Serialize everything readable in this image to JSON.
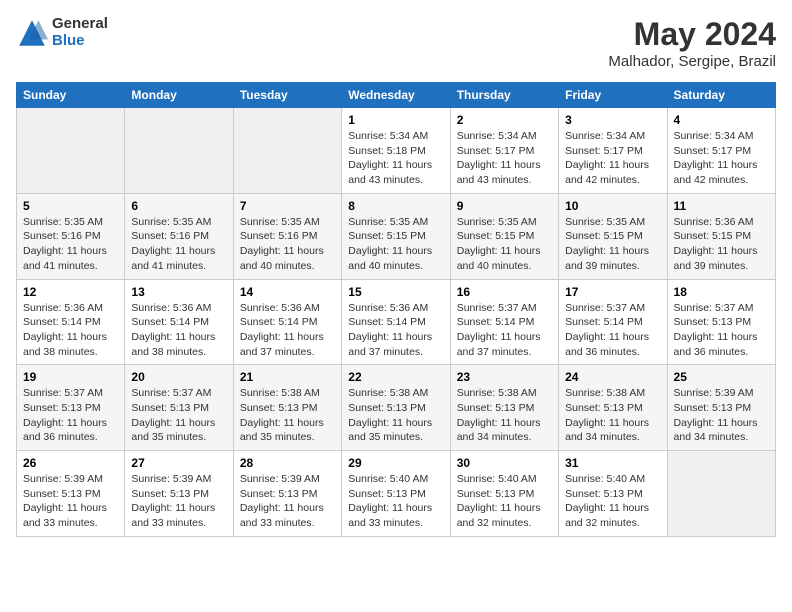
{
  "header": {
    "logo_general": "General",
    "logo_blue": "Blue",
    "month_year": "May 2024",
    "location": "Malhador, Sergipe, Brazil"
  },
  "days_of_week": [
    "Sunday",
    "Monday",
    "Tuesday",
    "Wednesday",
    "Thursday",
    "Friday",
    "Saturday"
  ],
  "weeks": [
    [
      {
        "day": "",
        "info": ""
      },
      {
        "day": "",
        "info": ""
      },
      {
        "day": "",
        "info": ""
      },
      {
        "day": "1",
        "info": "Sunrise: 5:34 AM\nSunset: 5:18 PM\nDaylight: 11 hours\nand 43 minutes."
      },
      {
        "day": "2",
        "info": "Sunrise: 5:34 AM\nSunset: 5:17 PM\nDaylight: 11 hours\nand 43 minutes."
      },
      {
        "day": "3",
        "info": "Sunrise: 5:34 AM\nSunset: 5:17 PM\nDaylight: 11 hours\nand 42 minutes."
      },
      {
        "day": "4",
        "info": "Sunrise: 5:34 AM\nSunset: 5:17 PM\nDaylight: 11 hours\nand 42 minutes."
      }
    ],
    [
      {
        "day": "5",
        "info": "Sunrise: 5:35 AM\nSunset: 5:16 PM\nDaylight: 11 hours\nand 41 minutes."
      },
      {
        "day": "6",
        "info": "Sunrise: 5:35 AM\nSunset: 5:16 PM\nDaylight: 11 hours\nand 41 minutes."
      },
      {
        "day": "7",
        "info": "Sunrise: 5:35 AM\nSunset: 5:16 PM\nDaylight: 11 hours\nand 40 minutes."
      },
      {
        "day": "8",
        "info": "Sunrise: 5:35 AM\nSunset: 5:15 PM\nDaylight: 11 hours\nand 40 minutes."
      },
      {
        "day": "9",
        "info": "Sunrise: 5:35 AM\nSunset: 5:15 PM\nDaylight: 11 hours\nand 40 minutes."
      },
      {
        "day": "10",
        "info": "Sunrise: 5:35 AM\nSunset: 5:15 PM\nDaylight: 11 hours\nand 39 minutes."
      },
      {
        "day": "11",
        "info": "Sunrise: 5:36 AM\nSunset: 5:15 PM\nDaylight: 11 hours\nand 39 minutes."
      }
    ],
    [
      {
        "day": "12",
        "info": "Sunrise: 5:36 AM\nSunset: 5:14 PM\nDaylight: 11 hours\nand 38 minutes."
      },
      {
        "day": "13",
        "info": "Sunrise: 5:36 AM\nSunset: 5:14 PM\nDaylight: 11 hours\nand 38 minutes."
      },
      {
        "day": "14",
        "info": "Sunrise: 5:36 AM\nSunset: 5:14 PM\nDaylight: 11 hours\nand 37 minutes."
      },
      {
        "day": "15",
        "info": "Sunrise: 5:36 AM\nSunset: 5:14 PM\nDaylight: 11 hours\nand 37 minutes."
      },
      {
        "day": "16",
        "info": "Sunrise: 5:37 AM\nSunset: 5:14 PM\nDaylight: 11 hours\nand 37 minutes."
      },
      {
        "day": "17",
        "info": "Sunrise: 5:37 AM\nSunset: 5:14 PM\nDaylight: 11 hours\nand 36 minutes."
      },
      {
        "day": "18",
        "info": "Sunrise: 5:37 AM\nSunset: 5:13 PM\nDaylight: 11 hours\nand 36 minutes."
      }
    ],
    [
      {
        "day": "19",
        "info": "Sunrise: 5:37 AM\nSunset: 5:13 PM\nDaylight: 11 hours\nand 36 minutes."
      },
      {
        "day": "20",
        "info": "Sunrise: 5:37 AM\nSunset: 5:13 PM\nDaylight: 11 hours\nand 35 minutes."
      },
      {
        "day": "21",
        "info": "Sunrise: 5:38 AM\nSunset: 5:13 PM\nDaylight: 11 hours\nand 35 minutes."
      },
      {
        "day": "22",
        "info": "Sunrise: 5:38 AM\nSunset: 5:13 PM\nDaylight: 11 hours\nand 35 minutes."
      },
      {
        "day": "23",
        "info": "Sunrise: 5:38 AM\nSunset: 5:13 PM\nDaylight: 11 hours\nand 34 minutes."
      },
      {
        "day": "24",
        "info": "Sunrise: 5:38 AM\nSunset: 5:13 PM\nDaylight: 11 hours\nand 34 minutes."
      },
      {
        "day": "25",
        "info": "Sunrise: 5:39 AM\nSunset: 5:13 PM\nDaylight: 11 hours\nand 34 minutes."
      }
    ],
    [
      {
        "day": "26",
        "info": "Sunrise: 5:39 AM\nSunset: 5:13 PM\nDaylight: 11 hours\nand 33 minutes."
      },
      {
        "day": "27",
        "info": "Sunrise: 5:39 AM\nSunset: 5:13 PM\nDaylight: 11 hours\nand 33 minutes."
      },
      {
        "day": "28",
        "info": "Sunrise: 5:39 AM\nSunset: 5:13 PM\nDaylight: 11 hours\nand 33 minutes."
      },
      {
        "day": "29",
        "info": "Sunrise: 5:40 AM\nSunset: 5:13 PM\nDaylight: 11 hours\nand 33 minutes."
      },
      {
        "day": "30",
        "info": "Sunrise: 5:40 AM\nSunset: 5:13 PM\nDaylight: 11 hours\nand 32 minutes."
      },
      {
        "day": "31",
        "info": "Sunrise: 5:40 AM\nSunset: 5:13 PM\nDaylight: 11 hours\nand 32 minutes."
      },
      {
        "day": "",
        "info": ""
      }
    ]
  ]
}
